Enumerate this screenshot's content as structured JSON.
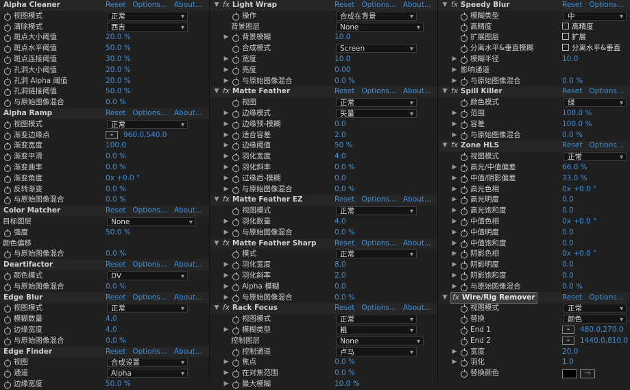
{
  "links": {
    "reset": "Reset",
    "options": "Options...",
    "about": "About..."
  },
  "columns": [
    [
      {
        "t": "h",
        "title": "Alpha Cleaner"
      },
      {
        "t": "p",
        "label": "视图模式",
        "dd": "正常"
      },
      {
        "t": "p",
        "label": "清除模式",
        "dd": "西吉"
      },
      {
        "t": "p",
        "label": "斑点大小阈值",
        "val": "20.0 %"
      },
      {
        "t": "p",
        "label": "斑点水平阈值",
        "val": "50.0 %"
      },
      {
        "t": "p",
        "label": "斑点连接阈值",
        "val": "30.0 %"
      },
      {
        "t": "p",
        "label": "孔洞大小阈值",
        "val": "20.0 %"
      },
      {
        "t": "p",
        "label": "孔洞 Alpha 阈值",
        "val": "20.0 %"
      },
      {
        "t": "p",
        "label": "孔洞链接阈值",
        "val": "50.0 %"
      },
      {
        "t": "p",
        "label": "与原始图像混合",
        "val": "0.0 %"
      },
      {
        "t": "h",
        "title": "Alpha Ramp"
      },
      {
        "t": "p",
        "label": "视图模式",
        "dd": "正常"
      },
      {
        "t": "p",
        "label": "渐变边缘点",
        "point": "960.0,540.0"
      },
      {
        "t": "p",
        "label": "渐变宽度",
        "val": "100.0"
      },
      {
        "t": "p",
        "label": "渐变平滑",
        "val": "0.0 %"
      },
      {
        "t": "p",
        "label": "渐变曲率",
        "val": "0.0 %"
      },
      {
        "t": "p",
        "label": "渐变角度",
        "val": "0x +0.0 °"
      },
      {
        "t": "p",
        "label": "反转渐变",
        "val": "0.0 %"
      },
      {
        "t": "p",
        "label": "与原始图像混合",
        "val": "0.0 %"
      },
      {
        "t": "h",
        "title": "Color Matcher"
      },
      {
        "t": "p",
        "plain": true,
        "label": "目标图层",
        "dd": "None",
        "ddw": 130
      },
      {
        "t": "p",
        "label": "强度",
        "val": "50.0 %"
      },
      {
        "t": "p",
        "plain": true,
        "label": "颜色偏移"
      },
      {
        "t": "p",
        "label": "与原始图像混合",
        "val": "0.0 %"
      },
      {
        "t": "h",
        "title": "Deartifactor"
      },
      {
        "t": "p",
        "label": "颜色模式",
        "dd": "DV"
      },
      {
        "t": "p",
        "label": "与原始图像混合",
        "val": "0.0 %"
      },
      {
        "t": "h",
        "title": "Edge Blur"
      },
      {
        "t": "p",
        "label": "视图模式",
        "dd": "正常"
      },
      {
        "t": "p",
        "label": "模糊数量",
        "val": "4.0"
      },
      {
        "t": "p",
        "label": "边缘宽度",
        "val": "4.0"
      },
      {
        "t": "p",
        "label": "与原始图像混合",
        "val": "0.0 %"
      },
      {
        "t": "h",
        "title": "Edge Finder"
      },
      {
        "t": "p",
        "label": "视图",
        "dd": "合成设置"
      },
      {
        "t": "p",
        "label": "通道",
        "dd": "Alpha"
      },
      {
        "t": "p",
        "label": "边缘宽度",
        "val": "50.0 %"
      }
    ],
    [
      {
        "t": "h",
        "fx": true,
        "arrow": "▼",
        "title": "Light Wrap"
      },
      {
        "t": "p",
        "label": "操作",
        "dd": "合成在背景"
      },
      {
        "t": "p",
        "plain": true,
        "label": "背景图层",
        "dd": "None",
        "ddw": 128
      },
      {
        "t": "p",
        "arrow": "▶",
        "label": "背景模糊",
        "val": "10.0"
      },
      {
        "t": "p",
        "label": "合成模式",
        "dd": "Screen"
      },
      {
        "t": "p",
        "arrow": "▶",
        "label": "宽度",
        "val": "10.0"
      },
      {
        "t": "p",
        "arrow": "▶",
        "label": "亮度",
        "val": "0.00"
      },
      {
        "t": "p",
        "arrow": "▶",
        "label": "与原始图像混合",
        "val": "0.0 %"
      },
      {
        "t": "h",
        "fx": true,
        "arrow": "▼",
        "title": "Matte Feather"
      },
      {
        "t": "p",
        "label": "视图",
        "dd": "正常"
      },
      {
        "t": "p",
        "arrow": "▶",
        "label": "边缘模式",
        "dd": "矢量"
      },
      {
        "t": "p",
        "arrow": "▶",
        "label": "边缘预-模糊",
        "val": "0.0"
      },
      {
        "t": "p",
        "arrow": "▶",
        "label": "适合容差",
        "val": "2.0"
      },
      {
        "t": "p",
        "arrow": "▶",
        "label": "边缘阈值",
        "val": "50 %"
      },
      {
        "t": "p",
        "arrow": "▶",
        "label": "羽化宽度",
        "val": "4.0"
      },
      {
        "t": "p",
        "arrow": "▶",
        "label": "羽化斜率",
        "val": "0.0 %"
      },
      {
        "t": "p",
        "arrow": "▶",
        "label": "过缘后-模糊",
        "val": "0.0"
      },
      {
        "t": "p",
        "arrow": "▶",
        "label": "与原始图像混合",
        "val": "0.0 %"
      },
      {
        "t": "h",
        "fx": true,
        "arrow": "▼",
        "title": "Matte Feather EZ"
      },
      {
        "t": "p",
        "label": "视图模式",
        "dd": "正常"
      },
      {
        "t": "p",
        "arrow": "▶",
        "label": "羽化数量",
        "val": "4.0"
      },
      {
        "t": "p",
        "arrow": "▶",
        "label": "与原始图像混合",
        "val": "0.0 %"
      },
      {
        "t": "h",
        "fx": true,
        "arrow": "▼",
        "title": "Matte Feather Sharp"
      },
      {
        "t": "p",
        "label": "模式",
        "dd": "正常"
      },
      {
        "t": "p",
        "arrow": "▶",
        "label": "羽化宽度",
        "val": "8.0"
      },
      {
        "t": "p",
        "arrow": "▶",
        "label": "羽化斜率",
        "val": "2.0"
      },
      {
        "t": "p",
        "arrow": "▶",
        "label": "Alpha 模糊",
        "val": "0.0"
      },
      {
        "t": "p",
        "arrow": "▶",
        "label": "与原始图像混合",
        "val": "0.0 %"
      },
      {
        "t": "h",
        "fx": true,
        "arrow": "▼",
        "title": "Rack Focus"
      },
      {
        "t": "p",
        "label": "视图模式",
        "dd": "正常"
      },
      {
        "t": "p",
        "arrow": "▶",
        "label": "模糊类型",
        "dd": "粗"
      },
      {
        "t": "p",
        "plain": true,
        "label": "控制图层",
        "dd": "None",
        "ddw": 128
      },
      {
        "t": "p",
        "label": "控制通道",
        "dd": "卢马"
      },
      {
        "t": "p",
        "arrow": "▶",
        "label": "焦点",
        "val": "0.0 %"
      },
      {
        "t": "p",
        "arrow": "▶",
        "label": "在对焦范围",
        "val": "0.0 %"
      },
      {
        "t": "p",
        "arrow": "▶",
        "label": "最大模糊",
        "val": "10.0 %"
      }
    ],
    [
      {
        "t": "h",
        "fx": true,
        "arrow": "▼",
        "title": "Speedy Blur"
      },
      {
        "t": "p",
        "label": "模糊类型",
        "dd": "中"
      },
      {
        "t": "p",
        "label": "高精度",
        "cb": "高精度"
      },
      {
        "t": "p",
        "label": "扩展图层",
        "cb": "扩展"
      },
      {
        "t": "p",
        "label": "分离水平&垂直模糊",
        "cb": "分离水平&垂直"
      },
      {
        "t": "p",
        "arrow": "▶",
        "label": "模糊半径",
        "val": "10.0"
      },
      {
        "t": "p",
        "plain": true,
        "arrow": "▶",
        "label": "影响通道"
      },
      {
        "t": "p",
        "arrow": "▶",
        "label": "与原始图像混合",
        "val": "0.0 %"
      },
      {
        "t": "h",
        "fx": true,
        "arrow": "▼",
        "title": "Spill Killer"
      },
      {
        "t": "p",
        "label": "颜色模式",
        "dd": "绿"
      },
      {
        "t": "p",
        "arrow": "▶",
        "label": "范围",
        "val": "100.0 %"
      },
      {
        "t": "p",
        "arrow": "▶",
        "label": "容差",
        "val": "100.0 %"
      },
      {
        "t": "p",
        "arrow": "▶",
        "label": "与原始图像混合",
        "val": "0.0 %"
      },
      {
        "t": "h",
        "fx": true,
        "arrow": "▼",
        "title": "Zone HLS"
      },
      {
        "t": "p",
        "label": "视图模式",
        "dd": "正常"
      },
      {
        "t": "p",
        "arrow": "▶",
        "label": "高光/中值偏差",
        "val": "66.0 %"
      },
      {
        "t": "p",
        "arrow": "▶",
        "label": "中值/阴影偏差",
        "val": "33.0 %"
      },
      {
        "t": "p",
        "arrow": "▶",
        "label": "高光色相",
        "val": "0x +0.0 °"
      },
      {
        "t": "p",
        "arrow": "▶",
        "label": "高光明度",
        "val": "0.0"
      },
      {
        "t": "p",
        "arrow": "▶",
        "label": "高光饱和度",
        "val": "0.0"
      },
      {
        "t": "p",
        "arrow": "▶",
        "label": "中值色相",
        "val": "0x +0.0 °"
      },
      {
        "t": "p",
        "arrow": "▶",
        "label": "中值明度",
        "val": "0.0"
      },
      {
        "t": "p",
        "arrow": "▶",
        "label": "中值饱和度",
        "val": "0.0"
      },
      {
        "t": "p",
        "arrow": "▶",
        "label": "阴影色相",
        "val": "0x +0.0 °"
      },
      {
        "t": "p",
        "arrow": "▶",
        "label": "阴影明度",
        "val": "0.0"
      },
      {
        "t": "p",
        "arrow": "▶",
        "label": "阴影饱和度",
        "val": "0.0"
      },
      {
        "t": "p",
        "arrow": "▶",
        "label": "与原始图像混合",
        "val": "0.0 %"
      },
      {
        "t": "h",
        "fx": true,
        "arrow": "▼",
        "title": "Wire/Rig Remover",
        "sel": true
      },
      {
        "t": "p",
        "label": "视图模式",
        "dd": "正常"
      },
      {
        "t": "p",
        "label": "替换",
        "dd": "颜色"
      },
      {
        "t": "p",
        "label": "End 1",
        "point": "480.0,270.0"
      },
      {
        "t": "p",
        "label": "End 2",
        "point": "1440.0,810.0"
      },
      {
        "t": "p",
        "arrow": "▶",
        "label": "宽度",
        "val": "20.0"
      },
      {
        "t": "p",
        "arrow": "▶",
        "label": "羽化",
        "val": "1.0"
      },
      {
        "t": "p",
        "label": "替换颜色",
        "color": "#000000"
      }
    ]
  ]
}
